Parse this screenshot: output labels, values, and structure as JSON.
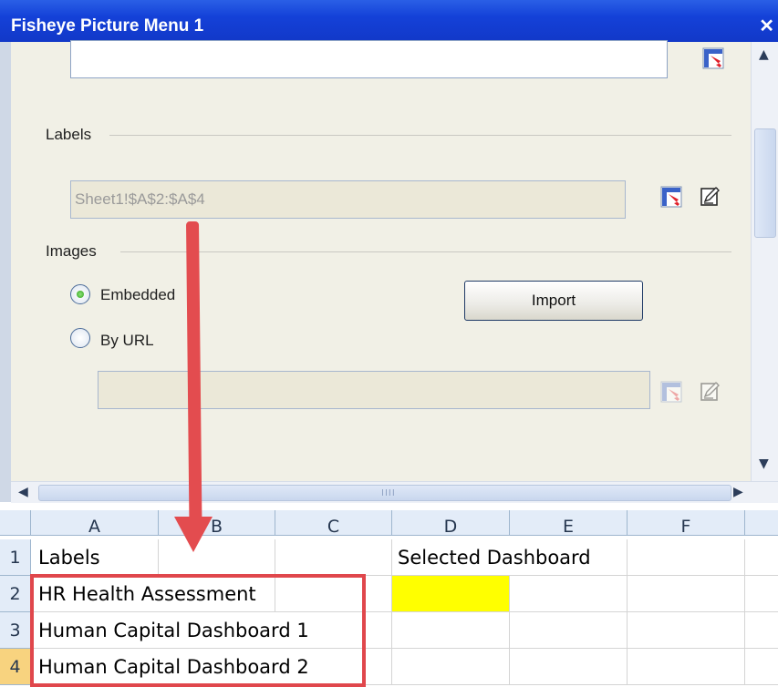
{
  "dialog": {
    "title": "Fisheye Picture Menu 1",
    "close_glyph": "✕",
    "labels_section": "Labels",
    "labels_range": "Sheet1!$A$2:$A$4",
    "images_section": "Images",
    "radio_embedded": "Embedded",
    "radio_url": "By URL",
    "import_button": "Import",
    "radio_selected": "Embedded"
  },
  "scrollbars": {
    "up_glyph": "▲",
    "down_glyph": "▼",
    "left_glyph": "◀",
    "right_glyph": "▶",
    "grip": "IIII"
  },
  "spreadsheet": {
    "columns": [
      "A",
      "B",
      "C",
      "D",
      "E",
      "F"
    ],
    "rows": [
      "1",
      "2",
      "3",
      "4"
    ],
    "cells": {
      "A1": "Labels",
      "D1": "Selected Dashboard",
      "A2": "HR Health Assessment",
      "A3": "Human Capital Dashboard 1",
      "A4": "Human Capital Dashboard 2"
    },
    "highlight_color": "#ffff00"
  },
  "annotation": {
    "arrow_color": "#e34c4f",
    "box_color": "#e0474c"
  },
  "icons": {
    "cell_picker": "range-select-icon",
    "edit": "edit-icon"
  }
}
